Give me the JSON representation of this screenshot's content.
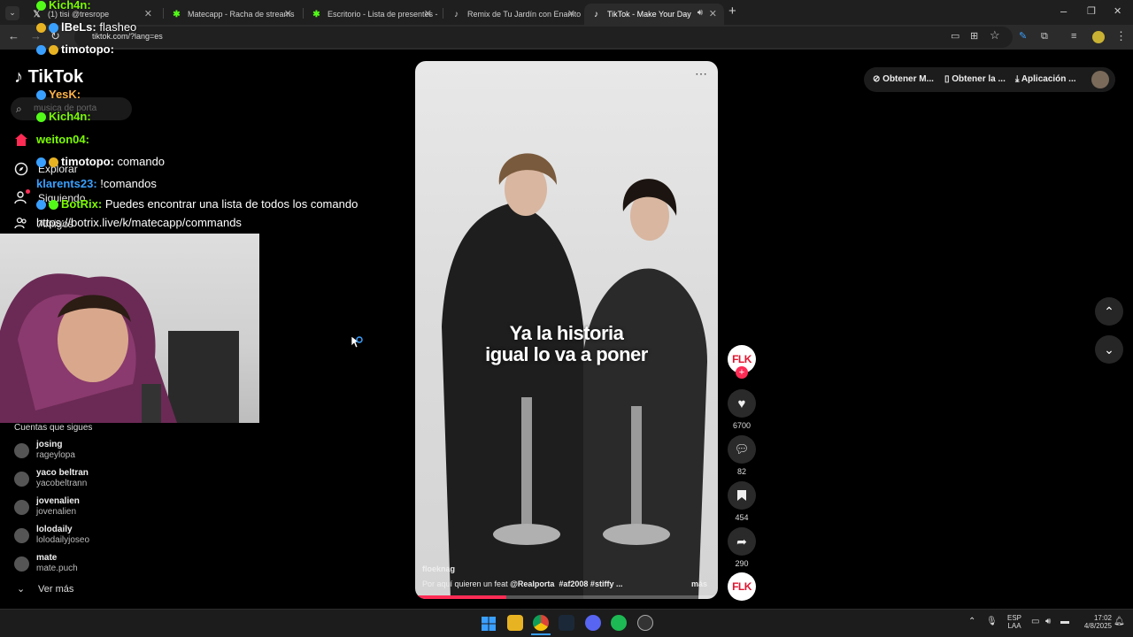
{
  "browser": {
    "tabs": [
      {
        "title": "(1) tisi @tresrope",
        "icon": "x-logo-icon"
      },
      {
        "title": "Matecapp - Racha de streams",
        "icon": "kick-icon"
      },
      {
        "title": "Escritorio - Lista de presentes -",
        "icon": "kick-icon"
      },
      {
        "title": "Remix de Tu Jardín con Enanito",
        "icon": "tiktok-icon"
      },
      {
        "title": "TikTok - Make Your Day",
        "icon": "tiktok-icon"
      }
    ],
    "url": "tiktok.com/?lang=es"
  },
  "tiktok": {
    "logo_text": "TikTok",
    "search_placeholder": "musica de porta",
    "nav": [
      "Explorar",
      "Siguiendo",
      "Amigos"
    ],
    "following_title": "Cuentas que sigues",
    "following": [
      {
        "name": "josing",
        "handle": "rageylopa"
      },
      {
        "name": "yaco beltran",
        "handle": "yacobeltrann"
      },
      {
        "name": "jovenalien",
        "handle": "jovenalien"
      },
      {
        "name": "lolodaily",
        "handle": "lolodailyjoseo"
      },
      {
        "name": "mate",
        "handle": "mate.puch"
      }
    ],
    "see_more": "Ver más",
    "top_actions": [
      "Obtener M...",
      "Obtener la ...",
      "Aplicación ..."
    ],
    "video": {
      "caption_line1": "Ya la historia",
      "caption_line2": "igual lo va a poner",
      "author": "floeknag",
      "description_prefix": "Por aquí quieren un feat",
      "mention": "@Realporta",
      "tags": "#af2008  #stiffy  ...",
      "more": "más",
      "progress_fraction": 0.3
    },
    "actions": {
      "creator": "FLK",
      "likes": "6700",
      "comments": "82",
      "saves": "454",
      "shares": "290",
      "sound": "FLK"
    }
  },
  "chat": [
    {
      "user": "Kich4n:",
      "msg": "",
      "color": "#7cfc00"
    },
    {
      "user": "lBeLs:",
      "msg": "flasheo",
      "color": "#ffffff"
    },
    {
      "user": "timotopo:",
      "msg": "",
      "color": "#ffffff"
    },
    {
      "user": "YesK:",
      "msg": "",
      "color": "#ffb347"
    },
    {
      "user": "Kich4n:",
      "msg": "",
      "color": "#7cfc00"
    },
    {
      "user": "weiton04:",
      "msg": "",
      "color": "#7cfc00"
    },
    {
      "user": "timotopo:",
      "msg": "comando",
      "color": "#ffffff"
    },
    {
      "user": "klarents23:",
      "msg": "!comandos",
      "color": "#3aa0ff"
    },
    {
      "user": "BotRix:",
      "msg": "Puedes encontrar una lista de todos los comando",
      "color": "#7cfc00"
    },
    {
      "user": "",
      "msg": "https://botrix.live/k/matecapp/commands",
      "color": "#ffffff"
    }
  ],
  "taskbar": {
    "lang_top": "ESP",
    "lang_bottom": "LAA",
    "time": "17:02",
    "date": "4/8/2025"
  },
  "colors": {
    "accent": "#fe2c55",
    "kick_green": "#53fc18"
  }
}
